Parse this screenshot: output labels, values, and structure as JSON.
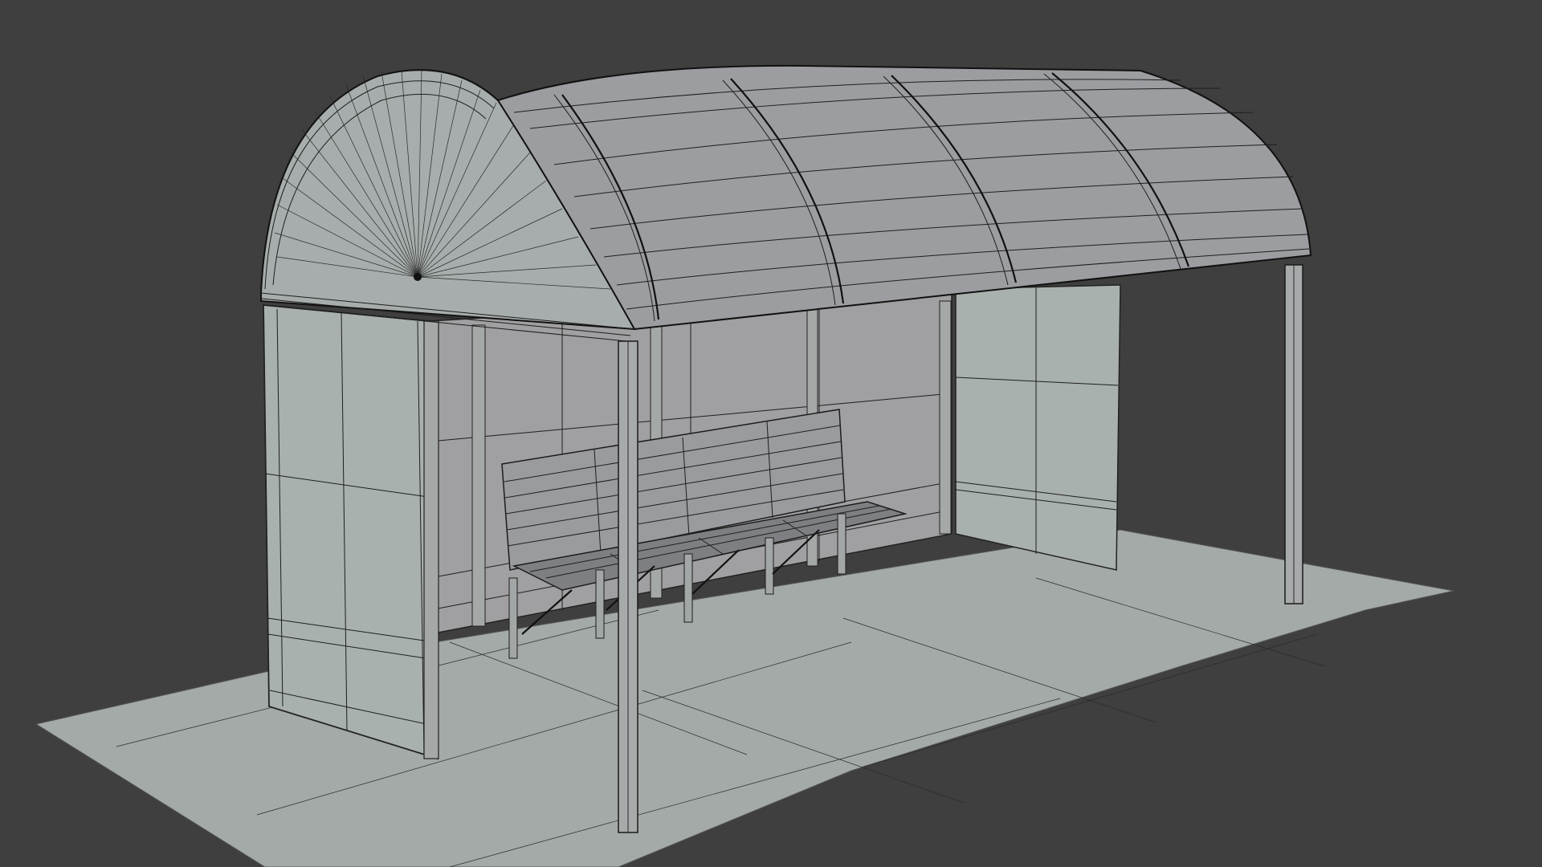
{
  "viewport": {
    "mode": "3d-viewport",
    "shading": "solid-with-wireframe-overlay",
    "background_color": "#3f3f3f"
  },
  "scene": {
    "object": "bus-shelter",
    "parts": [
      "ground-slab",
      "rear-glass-wall",
      "left-side-panel",
      "right-side-panel",
      "barrel-vault-roof",
      "roof-end-fan",
      "front-posts",
      "bench"
    ],
    "colors": {
      "ground": "#a3aaa7",
      "panel": "#a9b1ae",
      "rear_wall": "#a09fa1",
      "roof": "#9c9da1",
      "wire": "#1e1e1e"
    }
  }
}
